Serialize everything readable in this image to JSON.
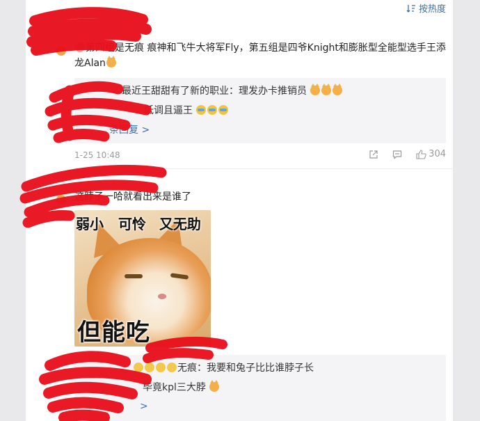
{
  "sort": {
    "label": "按热度",
    "icon": "sort-icon"
  },
  "comments": [
    {
      "text_parts": [
        "第四组是无痕 痕神和飞牛大将军Fly，第五组是四爷Knight和膨胀型全能型选手王添龙Alan"
      ],
      "replies": [
        {
          "text": "最近王甜甜有了新的职业：理发办卡推销员"
        },
        {
          "text": "低调且逼王"
        }
      ],
      "more_replies": "条回复 >",
      "time": "1-25 10:48",
      "likes": "304"
    },
    {
      "text": "这脖子一哈就看出来是谁了",
      "image": {
        "caption_top": [
          "弱小",
          "可怜",
          "又无助"
        ],
        "caption_bottom": "但能吃"
      },
      "replies": [
        {
          "text": "无痕：我要和兔子比比谁脖子长"
        },
        {
          "text": "毕竟kpl三大脖"
        }
      ],
      "more_replies": ">"
    }
  ],
  "colors": {
    "link": "#3b6ea8",
    "redaction": "#e8101c",
    "reply_bg": "#f4f4f6"
  }
}
